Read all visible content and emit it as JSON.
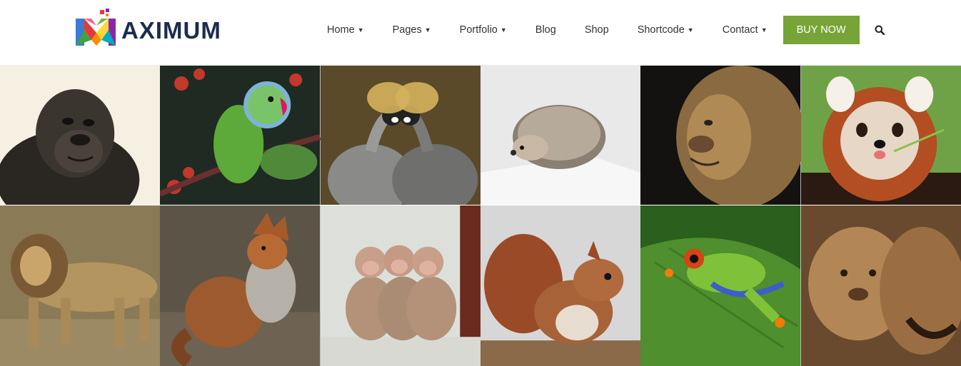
{
  "brand": {
    "name": "AXIMUM",
    "colors": {
      "text": "#1e2b4e",
      "accent": "#77a437"
    }
  },
  "nav": {
    "items": [
      {
        "label": "Home",
        "dropdown": true
      },
      {
        "label": "Pages",
        "dropdown": true
      },
      {
        "label": "Portfolio",
        "dropdown": true
      },
      {
        "label": "Blog",
        "dropdown": false
      },
      {
        "label": "Shop",
        "dropdown": false
      },
      {
        "label": "Shortcode",
        "dropdown": true
      },
      {
        "label": "Contact",
        "dropdown": true
      }
    ],
    "buy_label": "BUY NOW",
    "search_icon": "search-icon"
  },
  "gallery": {
    "items": [
      {
        "subject": "gorilla"
      },
      {
        "subject": "parrot"
      },
      {
        "subject": "crowned-cranes"
      },
      {
        "subject": "hedgehog"
      },
      {
        "subject": "lion-face"
      },
      {
        "subject": "red-panda"
      },
      {
        "subject": "lion-walking"
      },
      {
        "subject": "fox"
      },
      {
        "subject": "monkeys"
      },
      {
        "subject": "squirrel"
      },
      {
        "subject": "tree-frog"
      },
      {
        "subject": "lion-cub"
      }
    ]
  }
}
